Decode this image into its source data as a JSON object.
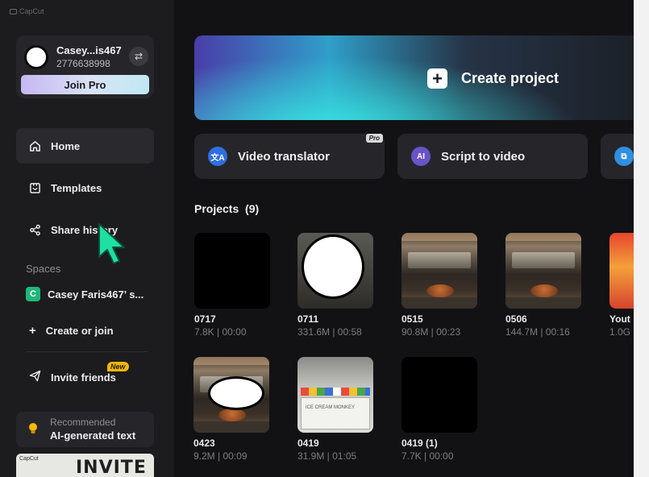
{
  "app": {
    "brand": "CapCut"
  },
  "account": {
    "name": "Casey...is467",
    "id": "2776638998",
    "join_label": "Join Pro"
  },
  "nav": [
    {
      "label": "Home",
      "icon": "home-icon",
      "active": true
    },
    {
      "label": "Templates",
      "icon": "templates-icon",
      "active": false
    },
    {
      "label": "Share history",
      "icon": "share-icon",
      "active": false
    }
  ],
  "spaces": {
    "label": "Spaces",
    "item": {
      "badge": "C",
      "label": "Casey Faris467’ s..."
    },
    "create_join": "Create or join"
  },
  "invite": {
    "label": "Invite friends",
    "badge": "New"
  },
  "recommended": {
    "small": "Recommended",
    "title": "AI-generated text"
  },
  "banner": {
    "brand": "CapCut",
    "text": "INVITE"
  },
  "hero": {
    "label": "Create project"
  },
  "tools": [
    {
      "label": "Video translator",
      "icon": "translate-icon",
      "tag": "Pro",
      "color": "#2f6fe0"
    },
    {
      "label": "Script to video",
      "icon": "ai-script-icon",
      "color": "#6a52c9"
    },
    {
      "label": "",
      "icon": "copy-icon",
      "color": "#2f8fe0"
    }
  ],
  "projects": {
    "title": "Projects",
    "count": "(9)",
    "items": [
      {
        "name": "0717",
        "meta": "7.8K | 00:00",
        "thumb": "black"
      },
      {
        "name": "0711",
        "meta": "331.6M | 00:58",
        "thumb": "person"
      },
      {
        "name": "0515",
        "meta": "90.8M | 00:23",
        "thumb": "kitchen"
      },
      {
        "name": "0506",
        "meta": "144.7M | 00:16",
        "thumb": "kitchen"
      },
      {
        "name": "Yout",
        "meta": "1.0G",
        "thumb": "youtube"
      },
      {
        "name": "0423",
        "meta": "9.2M | 00:09",
        "thumb": "kitchen-face"
      },
      {
        "name": "0419",
        "meta": "31.9M | 01:05",
        "thumb": "clapper"
      },
      {
        "name": "0419 (1)",
        "meta": "7.7K | 00:00",
        "thumb": "black"
      }
    ]
  },
  "clapper_text": "ICE CREAM MONKEY"
}
